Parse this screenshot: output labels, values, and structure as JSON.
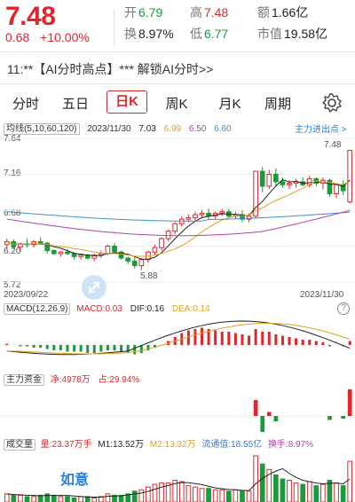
{
  "quote": {
    "price": "7.48",
    "change": "0.68",
    "change_pct": "+10.00%",
    "fields": [
      {
        "label": "开",
        "value": "6.79",
        "color": "#1a9a3b"
      },
      {
        "label": "高",
        "value": "7.48",
        "color": "#e0262d"
      },
      {
        "label": "额",
        "value": "1.66亿",
        "color": "#222222"
      },
      {
        "label": "换",
        "value": "8.97%",
        "color": "#222222"
      },
      {
        "label": "低",
        "value": "6.77",
        "color": "#1a9a3b"
      },
      {
        "label": "市值",
        "value": "19.58亿",
        "color": "#222222"
      }
    ]
  },
  "banner": "11:**【AI分时高点】*** 解锁AI分时>>",
  "tabs": [
    "分时",
    "五日",
    "日K",
    "周K",
    "月K",
    "周期"
  ],
  "active_tab": "日K",
  "main_legend": {
    "label": "均线(5,10,60,120)",
    "date": "2023/11/30",
    "ma5": "7.03",
    "ma10": "6.99",
    "ma60": "6.50",
    "ma120": "6.60",
    "link": "主力进出点 >"
  },
  "price_axis": [
    "7.64",
    "7.16",
    "6.68",
    "6.20",
    "5.72"
  ],
  "annotations": {
    "high": "7.48",
    "low": "5.88"
  },
  "date_range": {
    "start": "2023/09/22",
    "end": "2023/11/30"
  },
  "macd": {
    "label": "MACD(12,26,9)",
    "macd": "MACD:0.03",
    "dif": "DIF:0.16",
    "dea": "DEA:0.14"
  },
  "funds": {
    "label": "主力资金",
    "net": "净:4978万",
    "ratio": "占:29.94%"
  },
  "volume": {
    "label": "成交量",
    "amount": "量:23.37万手",
    "m1": "M1:13.52万",
    "m2": "M2:13.32万",
    "float_value": "流通值:18.55亿",
    "turnover": "换手:8.97%"
  },
  "watermark": "如意",
  "colors": {
    "up": "#e0262d",
    "down": "#1a9a3b",
    "ma5": "#222222",
    "ma10": "#e0a020",
    "ma60": "#3f8fc6",
    "ma120": "#b040b0"
  },
  "chart_data": {
    "type": "candlestick",
    "ylim": [
      5.72,
      7.64
    ],
    "candles": [
      [
        6.22,
        6.3,
        6.16,
        6.26
      ],
      [
        6.26,
        6.29,
        6.16,
        6.19
      ],
      [
        6.19,
        6.25,
        6.12,
        6.23
      ],
      [
        6.23,
        6.3,
        6.18,
        6.22
      ],
      [
        6.22,
        6.28,
        6.18,
        6.26
      ],
      [
        6.26,
        6.32,
        6.22,
        6.24
      ],
      [
        6.24,
        6.26,
        6.1,
        6.14
      ],
      [
        6.14,
        6.16,
        6.08,
        6.1
      ],
      [
        6.1,
        6.14,
        6.06,
        6.12
      ],
      [
        6.12,
        6.16,
        6.08,
        6.1
      ],
      [
        6.1,
        6.12,
        6.02,
        6.06
      ],
      [
        6.06,
        6.1,
        6.02,
        6.08
      ],
      [
        6.08,
        6.1,
        6.02,
        6.04
      ],
      [
        6.04,
        6.1,
        6.0,
        6.08
      ],
      [
        6.08,
        6.14,
        6.04,
        6.1
      ],
      [
        6.1,
        6.22,
        6.08,
        6.2
      ],
      [
        6.2,
        6.24,
        6.1,
        6.12
      ],
      [
        6.12,
        6.14,
        6.02,
        6.04
      ],
      [
        6.04,
        6.06,
        5.96,
        6.0
      ],
      [
        6.0,
        6.06,
        5.9,
        5.94
      ],
      [
        5.94,
        6.04,
        5.88,
        6.02
      ],
      [
        6.02,
        6.14,
        5.98,
        6.12
      ],
      [
        6.12,
        6.22,
        6.08,
        6.18
      ],
      [
        6.18,
        6.32,
        6.14,
        6.3
      ],
      [
        6.3,
        6.42,
        6.26,
        6.4
      ],
      [
        6.4,
        6.52,
        6.36,
        6.5
      ],
      [
        6.5,
        6.6,
        6.46,
        6.56
      ],
      [
        6.56,
        6.62,
        6.52,
        6.58
      ],
      [
        6.58,
        6.66,
        6.54,
        6.62
      ],
      [
        6.62,
        6.68,
        6.58,
        6.64
      ],
      [
        6.64,
        6.7,
        6.56,
        6.6
      ],
      [
        6.6,
        6.66,
        6.56,
        6.64
      ],
      [
        6.64,
        6.7,
        6.6,
        6.66
      ],
      [
        6.66,
        6.7,
        6.58,
        6.6
      ],
      [
        6.6,
        6.66,
        6.56,
        6.62
      ],
      [
        6.62,
        6.68,
        6.52,
        6.56
      ],
      [
        6.56,
        6.64,
        6.52,
        6.6
      ],
      [
        6.6,
        7.2,
        6.58,
        7.2
      ],
      [
        7.2,
        7.26,
        6.92,
        7.0
      ],
      [
        7.0,
        7.22,
        6.96,
        7.16
      ],
      [
        7.16,
        7.24,
        7.0,
        7.06
      ],
      [
        7.06,
        7.12,
        6.98,
        7.02
      ],
      [
        7.02,
        7.08,
        6.96,
        7.04
      ],
      [
        7.04,
        7.1,
        6.98,
        7.06
      ],
      [
        7.06,
        7.12,
        7.0,
        7.02
      ],
      [
        7.02,
        7.14,
        6.98,
        7.1
      ],
      [
        7.1,
        7.12,
        7.0,
        7.04
      ],
      [
        7.04,
        7.12,
        6.96,
        7.08
      ],
      [
        7.08,
        7.1,
        6.86,
        6.9
      ],
      [
        6.9,
        7.04,
        6.84,
        7.02
      ],
      [
        7.02,
        7.08,
        6.88,
        6.94
      ],
      [
        6.79,
        7.48,
        6.77,
        7.48
      ]
    ],
    "volume": [
      6,
      5,
      5,
      4,
      4,
      5,
      6,
      5,
      4,
      4,
      3,
      4,
      4,
      3,
      4,
      6,
      5,
      5,
      6,
      8,
      9,
      11,
      13,
      14,
      14,
      16,
      15,
      12,
      11,
      10,
      10,
      9,
      9,
      8,
      9,
      8,
      8,
      34,
      28,
      24,
      20,
      17,
      16,
      14,
      13,
      15,
      12,
      13,
      16,
      14,
      12,
      30
    ],
    "macd": [
      0.01,
      0.0,
      -0.01,
      -0.01,
      -0.02,
      -0.02,
      -0.03,
      -0.04,
      -0.04,
      -0.05,
      -0.05,
      -0.05,
      -0.06,
      -0.06,
      -0.05,
      -0.04,
      -0.04,
      -0.05,
      -0.06,
      -0.07,
      -0.06,
      -0.04,
      -0.02,
      0.0,
      0.03,
      0.06,
      0.09,
      0.11,
      0.12,
      0.13,
      0.12,
      0.11,
      0.1,
      0.1,
      0.09,
      0.08,
      0.07,
      0.12,
      0.1,
      0.1,
      0.08,
      0.07,
      0.06,
      0.05,
      0.04,
      0.04,
      0.03,
      0.02,
      -0.01,
      0.0,
      -0.01,
      0.03
    ],
    "funds": [
      0,
      0,
      0,
      0,
      0,
      0,
      0,
      0,
      0,
      0,
      0,
      0,
      0,
      0,
      0,
      0,
      0,
      0,
      0,
      0,
      0,
      0,
      0,
      0,
      0,
      0,
      0,
      0,
      0,
      0,
      0,
      0,
      0,
      0,
      0,
      0,
      0,
      0.6,
      -0.7,
      0.15,
      -0.2,
      0,
      0,
      0,
      0,
      0,
      0,
      0,
      -0.15,
      0,
      -0.1,
      1
    ]
  }
}
